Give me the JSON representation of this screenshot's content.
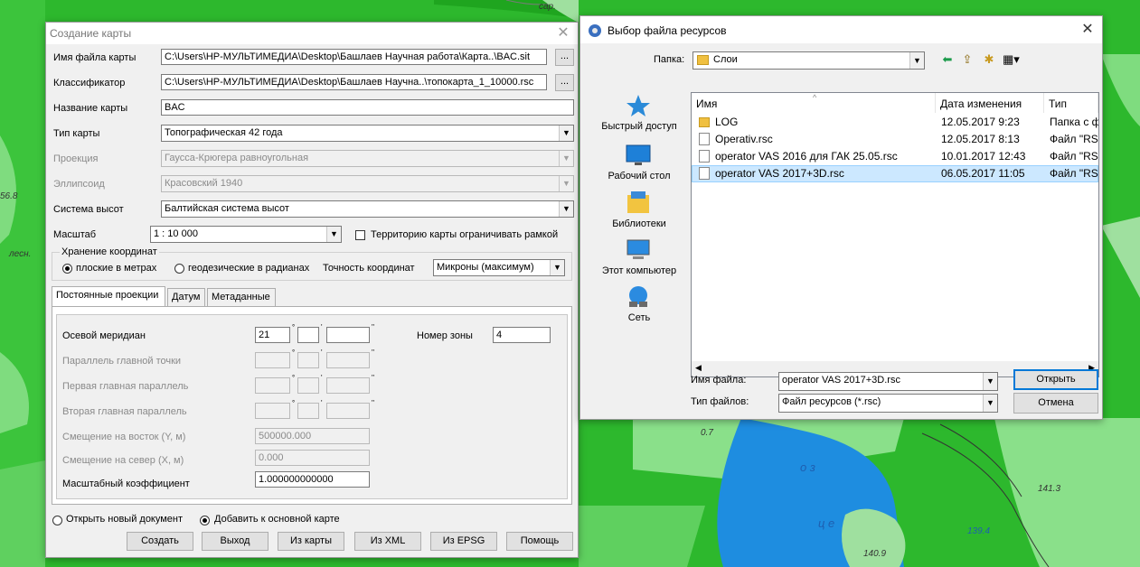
{
  "map": {
    "labels": [
      "сар.",
      "56.8",
      "лесн.",
      "0.7",
      "141.3",
      "139.4",
      "140.9",
      "о з",
      "ц е"
    ]
  },
  "create_dialog": {
    "title": "Создание карты",
    "fields": {
      "map_file_label": "Имя файла карты",
      "map_file_value": "C:\\Users\\HP-МУЛЬТИМЕДИА\\Desktop\\Башлаев Научная работа\\Карта..\\BAC.sit",
      "classifier_label": "Классификатор",
      "classifier_value": "C:\\Users\\HP-МУЛЬТИМЕДИА\\Desktop\\Башлаев Научна..\\топокарта_1_10000.rsc",
      "map_name_label": "Название карты",
      "map_name_value": "BAC",
      "map_type_label": "Тип карты",
      "map_type_value": "Топографическая 42 года",
      "projection_label": "Проекция",
      "projection_value": "Гаусса-Крюгера равноугольная",
      "ellipsoid_label": "Эллипсоид",
      "ellipsoid_value": "Красовский 1940",
      "height_system_label": "Система высот",
      "height_system_value": "Балтийская система высот",
      "scale_label": "Масштаб",
      "scale_value": "1 : 10 000",
      "limit_territory_label": "Территорию карты ограничивать рамкой"
    },
    "browse_label": "...",
    "storage": {
      "legend": "Хранение координат",
      "flat_label": "плоские в метрах",
      "geo_label": "геодезические в радианах",
      "precision_label": "Точность координат",
      "precision_value": "Микроны (максимум)"
    },
    "tabs": [
      "Постоянные проекции",
      "Датум",
      "Метаданные"
    ],
    "projection_params": {
      "central_meridian_label": "Осевой меридиан",
      "central_meridian_deg": "21",
      "zone_label": "Номер зоны",
      "zone_value": "4",
      "main_parallel_label": "Параллель главной точки",
      "first_parallel_label": "Первая главная параллель",
      "second_parallel_label": "Вторая главная параллель",
      "east_offset_label": "Смещение на восток (Y, м)",
      "east_offset_value": "500000.000",
      "north_offset_label": "Смещение на север (X, м)",
      "north_offset_value": "0.000",
      "scale_factor_label": "Масштабный коэффициент",
      "scale_factor_value": "1.000000000000",
      "degree_mark": "°",
      "minute_mark": "'",
      "second_mark": "''"
    },
    "open_new_label": "Открыть новый документ",
    "add_to_main_label": "Добавить к основной карте",
    "buttons": {
      "create": "Создать",
      "exit": "Выход",
      "from_map": "Из карты",
      "from_xml": "Из XML",
      "from_epsg": "Из EPSG",
      "help": "Помощь"
    }
  },
  "file_dialog": {
    "title": "Выбор файла ресурсов",
    "folder_label": "Папка:",
    "folder_value": "Слои",
    "places": [
      "Быстрый доступ",
      "Рабочий стол",
      "Библиотеки",
      "Этот компьютер",
      "Сеть"
    ],
    "columns": [
      "Имя",
      "Дата изменения",
      "Тип"
    ],
    "files": [
      {
        "name": "LOG",
        "date": "12.05.2017 9:23",
        "type": "Папка с ф"
      },
      {
        "name": "Operativ.rsc",
        "date": "12.05.2017 8:13",
        "type": "Файл \"RSC"
      },
      {
        "name": "operator VAS 2016 для ГАК 25.05.rsc",
        "date": "10.01.2017 12:43",
        "type": "Файл \"RSC"
      },
      {
        "name": "operator VAS 2017+3D.rsc",
        "date": "06.05.2017 11:05",
        "type": "Файл \"RSC"
      }
    ],
    "filename_label": "Имя файла:",
    "filename_value": "operator VAS 2017+3D.rsc",
    "filetype_label": "Тип файлов:",
    "filetype_value": "Файл ресурсов (*.rsc)",
    "open_button": "Открыть",
    "cancel_button": "Отмена"
  }
}
